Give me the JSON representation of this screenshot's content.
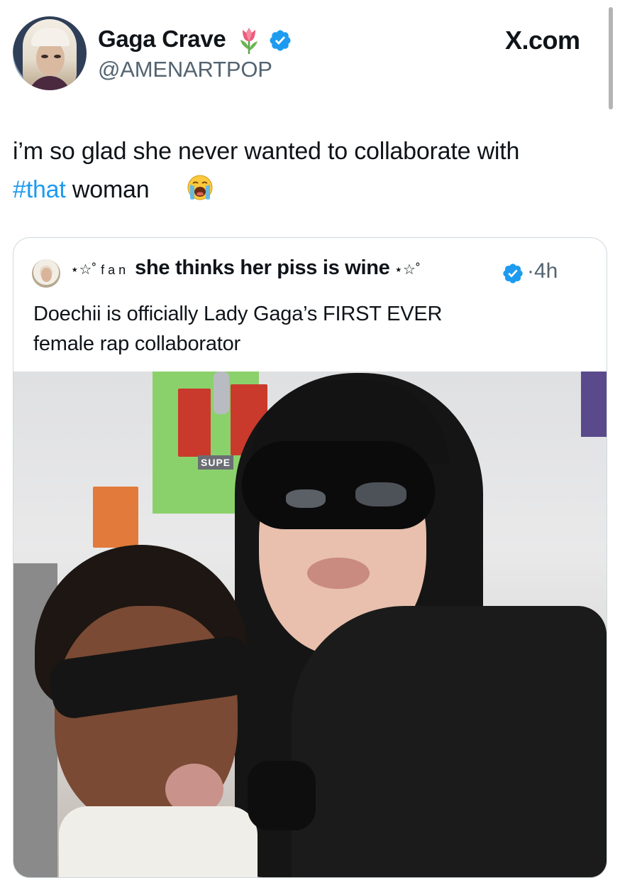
{
  "tweet": {
    "author_name": "Gaga Crave",
    "author_handle": "@AMENARTPOP",
    "site_label": "X.com",
    "text_before": "i’m so glad she never wanted to collaborate with",
    "hashtag": "#that",
    "text_after": "woman",
    "emoji": "loudly-crying-face"
  },
  "quote": {
    "name_prefix_stars": "⋆☆˚",
    "name_prefix_word": "fan",
    "author_name": "she thinks her piss is wine",
    "name_suffix": "⋆☆˚",
    "separator": "·",
    "time": "4h",
    "text_line1": "Doechii is officially Lady Gaga’s FIRST EVER",
    "text_line2": "female rap collaborator",
    "photo_sign_text": "SUPE"
  },
  "colors": {
    "link": "#1d9bf0",
    "verified": "#1d9bf0",
    "handle": "#536471",
    "border": "#cfd9de"
  },
  "icons": [
    "tulip-icon",
    "verified-badge-icon",
    "crying-face-icon"
  ]
}
